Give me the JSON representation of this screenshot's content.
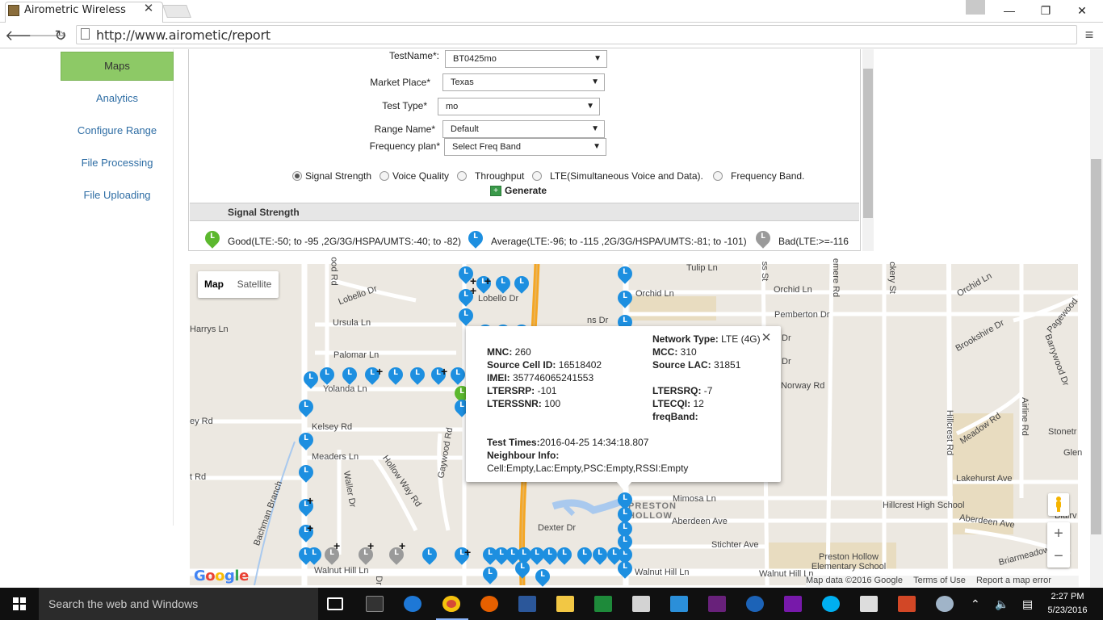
{
  "browser": {
    "tab_title": "Airometric Wireless",
    "tab_close": "✕",
    "url": "http://www.airometic/report",
    "window_controls": {
      "minimize": "—",
      "maximize": "❐",
      "close": "✕"
    },
    "icons": [
      "back-icon",
      "forward-icon",
      "reload-icon",
      "page-icon",
      "menu-icon"
    ]
  },
  "sidebar": {
    "items": [
      {
        "label": "Maps",
        "active": true
      },
      {
        "label": "Analytics"
      },
      {
        "label": "Configure Range"
      },
      {
        "label": "File Processing"
      },
      {
        "label": "File Uploading"
      }
    ]
  },
  "form": {
    "test_name": {
      "label": "TestName*:",
      "value": "BT0425mo"
    },
    "market_place": {
      "label": "Market Place*",
      "value": "Texas"
    },
    "test_type": {
      "label": "Test Type*",
      "value": "mo"
    },
    "range_name": {
      "label": "Range Name*",
      "value": "Default"
    },
    "frequency_plan": {
      "label": "Frequency plan*",
      "value": "Select Freq Band"
    },
    "radios": [
      {
        "label": "Signal Strength",
        "selected": true
      },
      {
        "label": "Voice Quality",
        "selected": false
      },
      {
        "label": "Throughput",
        "selected": false
      },
      {
        "label": "LTE(Simultaneous Voice and Data).",
        "selected": false
      },
      {
        "label": "Frequency Band.",
        "selected": false
      }
    ],
    "generate_label": "Generate"
  },
  "signal_strength": {
    "title": "Signal Strength",
    "pin_letter": "L",
    "legend": [
      {
        "text": "Good(LTE:-50; to -95 ,2G/3G/HSPA/UMTS:-40; to -82)",
        "color": "#5cb82e"
      },
      {
        "text": "Average(LTE:-96; to -115 ,2G/3G/HSPA/UMTS:-81; to -101)",
        "color": "#1d8fe0"
      },
      {
        "text": "Bad(LTE:>=-116",
        "color": "#9a9a9a"
      }
    ]
  },
  "map": {
    "map_button": "Map",
    "satellite_button": "Satellite",
    "roads": [
      "Tulip Ln",
      "Orchid Ln",
      "Orchid Ln",
      "Orchid Ln",
      "Pemberton Dr",
      "Lobello Dr",
      "Lobello Dr",
      "Ursula Ln",
      "Harrys Ln",
      "Palomar Ln",
      "Yolanda Ln",
      "Kelsey Rd",
      "Meaders Ln",
      "Mimosa Ln",
      "Aberdeen Ave",
      "Aberdeen Ave",
      "Dexter Dr",
      "Stichter Ave",
      "Walnut Hill Ln",
      "Walnut Hill Ln",
      "Walnut Hill Ln",
      "Lakehurst Ave",
      "Hillcrest High School",
      "Preston Hollow Elementary School",
      "Bachman Branch",
      "Hollow Way Rd",
      "Gaywood Rd",
      "Waller Dr",
      "Meadow Rd",
      "Hillcrest Rd",
      "Brookshire Dr",
      "Pagewood",
      "Briarmeadow",
      "Norway Rd",
      "Stonetr",
      "Glen",
      "Blairv",
      "PRESTON HOLLOW",
      "ood Rd",
      "ey Rd",
      "t Rd",
      "ns Dr",
      "emere Rd",
      "ckery St",
      "Barrywood Dr",
      "Airline Rd",
      "Dr",
      "Dr",
      "ss St",
      "Dr"
    ],
    "infowindow": {
      "network_type": {
        "k": "Network Type:",
        "v": "LTE (4G)"
      },
      "mnc": {
        "k": "MNC:",
        "v": "260"
      },
      "mcc": {
        "k": "MCC:",
        "v": "310"
      },
      "source_cell_id": {
        "k": "Source Cell ID:",
        "v": "16518402"
      },
      "source_lac": {
        "k": "Source LAC:",
        "v": "31851"
      },
      "imei": {
        "k": "IMEI:",
        "v": "357746065241553"
      },
      "ltersrp": {
        "k": "LTERSRP:",
        "v": "-101"
      },
      "ltersrq": {
        "k": "LTERSRQ:",
        "v": "-7"
      },
      "ltersnr": {
        "k": "LTERSSNR:",
        "v": "100"
      },
      "ltecqi": {
        "k": "LTECQI:",
        "v": "12"
      },
      "freqband": {
        "k": "freqBand:",
        "v": ""
      },
      "test_times": {
        "k": "Test Times:",
        "v": "2016-04-25 14:34:18.807"
      },
      "neighbour": {
        "k": "Neighbour Info:",
        "v": "Cell:Empty,Lac:Empty,PSC:Empty,RSSI:Empty"
      }
    },
    "zoom_in": "+",
    "zoom_out": "−",
    "google_logo": "Google",
    "attribution": [
      "Map data ©2016 Google",
      "Terms of Use",
      "Report a map error"
    ]
  },
  "taskbar": {
    "search_placeholder": "Search the web and Windows",
    "time": "2:27 PM",
    "date": "5/23/2016"
  }
}
